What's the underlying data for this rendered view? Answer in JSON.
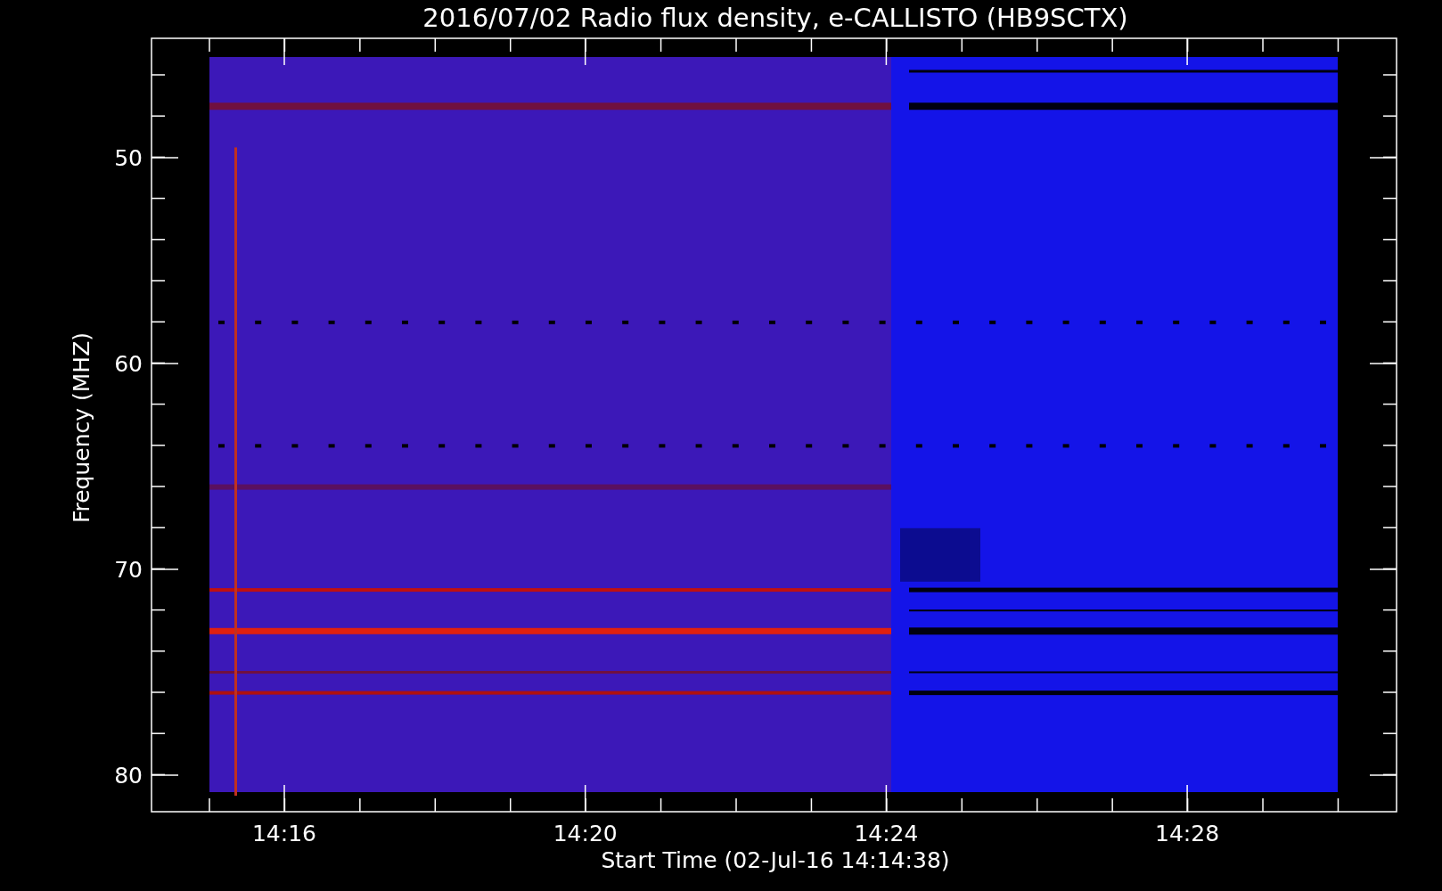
{
  "title": "2016/07/02  Radio flux density, e-CALLISTO (HB9SCTX)",
  "y_axis": {
    "label": "Frequency (MHZ)",
    "ticks": [
      "50",
      "60",
      "70",
      "80"
    ]
  },
  "x_axis": {
    "label": "Start Time (02-Jul-16 14:14:38)",
    "ticks": [
      "14:16",
      "14:20",
      "14:24",
      "14:28"
    ]
  }
}
